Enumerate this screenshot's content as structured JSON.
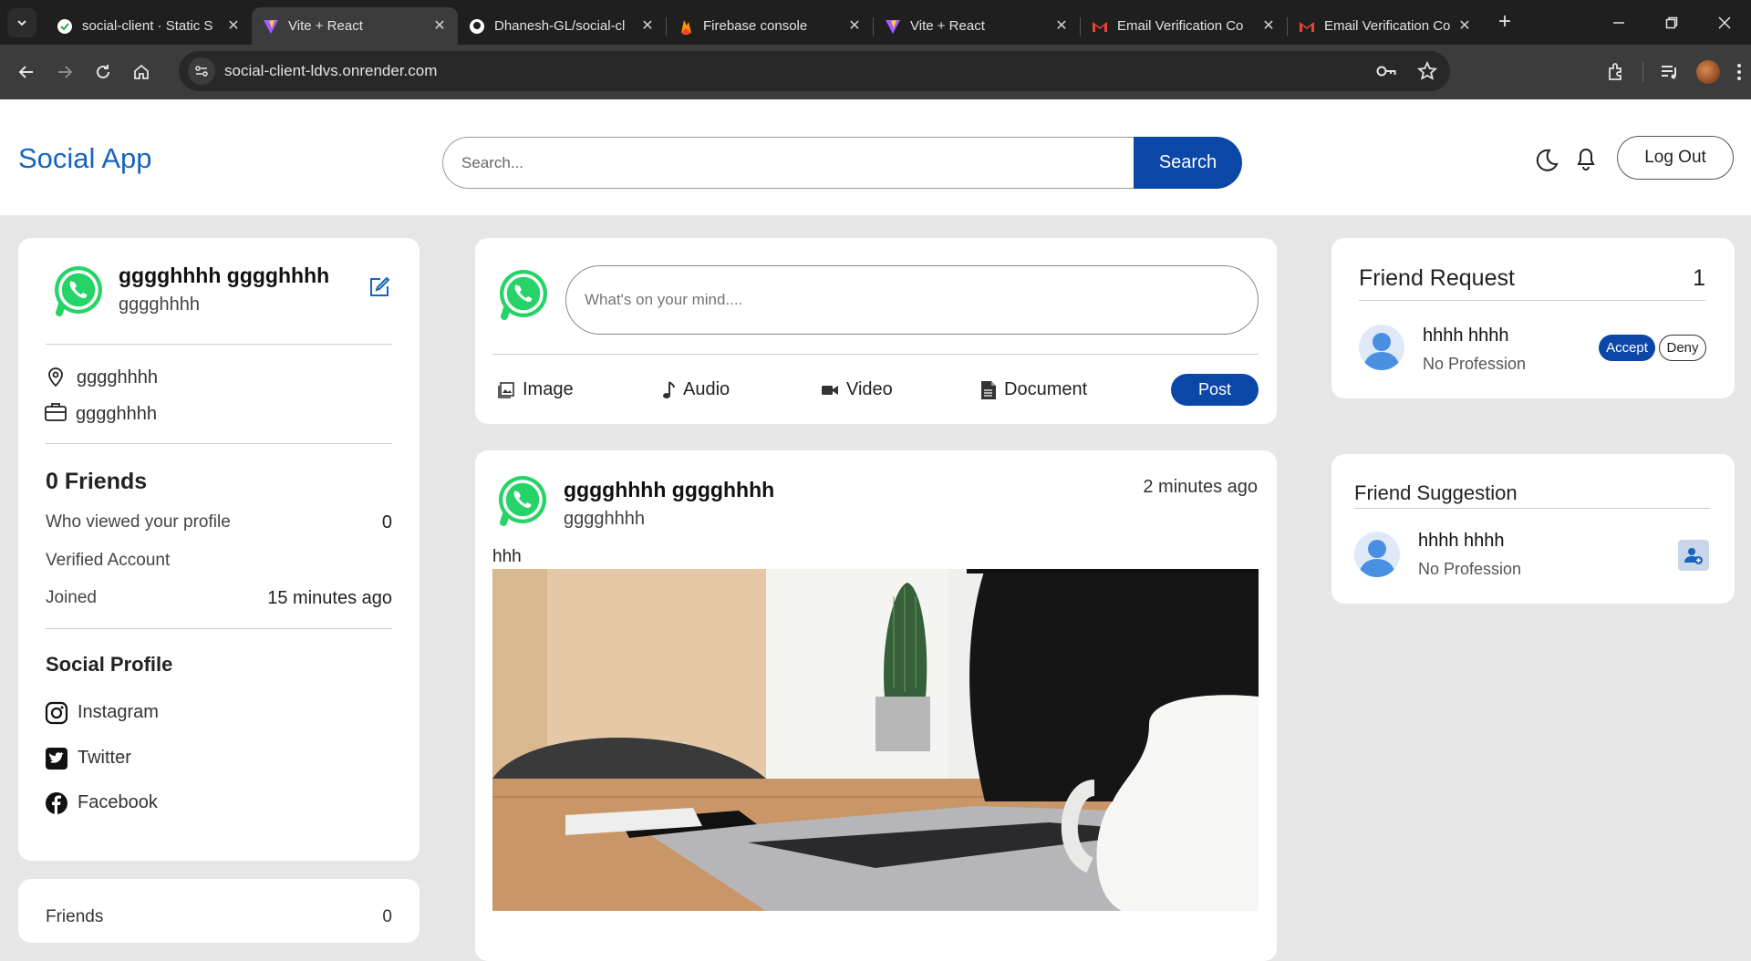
{
  "browser": {
    "tabs": [
      {
        "title": "social-client · Static S",
        "favicon": "render-icon"
      },
      {
        "title": "Vite + React",
        "favicon": "vite-icon",
        "active": true
      },
      {
        "title": "Dhanesh-GL/social-cl",
        "favicon": "github-icon"
      },
      {
        "title": "Firebase console",
        "favicon": "firebase-icon"
      },
      {
        "title": "Vite + React",
        "favicon": "vite-icon"
      },
      {
        "title": "Email Verification Co",
        "favicon": "gmail-icon"
      },
      {
        "title": "Email Verification Co",
        "favicon": "gmail-icon"
      }
    ],
    "url": "social-client-ldvs.onrender.com"
  },
  "header": {
    "brand": "Social App",
    "search_placeholder": "Search...",
    "search_button": "Search",
    "logout": "Log Out"
  },
  "profile": {
    "name": "gggghhhh gggghhhh",
    "username": "gggghhhh",
    "location": "gggghhhh",
    "profession": "gggghhhh",
    "friends_label": "0 Friends",
    "stats": [
      {
        "label": "Who viewed your profile",
        "value": "0"
      },
      {
        "label": "Verified Account",
        "value": ""
      },
      {
        "label": "Joined",
        "value": "15 minutes ago"
      }
    ],
    "social_title": "Social Profile",
    "social": [
      "Instagram",
      "Twitter",
      "Facebook"
    ]
  },
  "friends_card": {
    "label": "Friends",
    "value": "0"
  },
  "composer": {
    "placeholder": "What's on your mind....",
    "options": [
      "Image",
      "Audio",
      "Video",
      "Document"
    ],
    "post_button": "Post"
  },
  "post": {
    "name": "gggghhhh gggghhhh",
    "username": "gggghhhh",
    "time": "2 minutes ago",
    "text": "hhh"
  },
  "friend_request": {
    "title": "Friend Request",
    "count": "1",
    "name": "hhhh hhhh",
    "profession": "No Profession",
    "accept": "Accept",
    "deny": "Deny"
  },
  "friend_suggestion": {
    "title": "Friend Suggestion",
    "name": "hhhh hhhh",
    "profession": "No Profession"
  },
  "colors": {
    "brand": "#1565c0",
    "primary_button": "#0b47a6",
    "whatsapp": "#25d366"
  }
}
